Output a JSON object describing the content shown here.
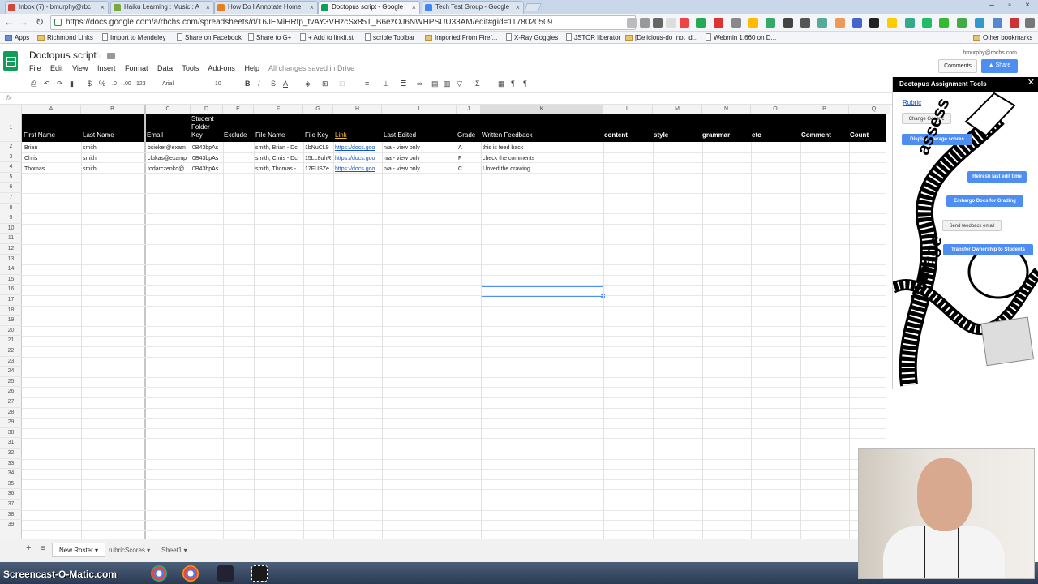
{
  "browser": {
    "tabs": [
      {
        "label": "Inbox (7) - bmurphy@rbc",
        "color": "#d44638"
      },
      {
        "label": "Haiku Learning : Music : A",
        "color": "#7aa83a"
      },
      {
        "label": "How Do I Annotate Home",
        "color": "#e67e22"
      },
      {
        "label": "Doctopus script - Google",
        "color": "#0f9d58",
        "active": true
      },
      {
        "label": "Tech Test Group - Google",
        "color": "#4285f4"
      }
    ],
    "url": "https://docs.google.com/a/rbchs.com/spreadsheets/d/16JEMiHRtp_tvAY3VHzcSx85T_B6ezOJ6NWHPSUU33AM/edit#gid=1178020509",
    "bookmarks": [
      "Apps",
      "Richmond Links",
      "Import to Mendeley",
      "Share on Facebook",
      "Share to G+",
      "+ Add to linkli.st",
      "scrible Toolbar",
      "Imported From Firef...",
      "X-Ray Goggles",
      "JSTOR liberator",
      "[Delicious-do_not_d...",
      "Webmin 1.660 on D...",
      "Other bookmarks"
    ]
  },
  "sheets": {
    "title": "Doctopus script",
    "menus": [
      "File",
      "Edit",
      "View",
      "Insert",
      "Format",
      "Data",
      "Tools",
      "Add-ons",
      "Help"
    ],
    "saved_status": "All changes saved in Drive",
    "user": "bmurphy@rbchs.com",
    "comments_label": "Comments",
    "share_label": "Share",
    "font_name": "Arial",
    "font_size": "10",
    "number_format": "123",
    "fx": "fx"
  },
  "grid": {
    "columns": [
      "A",
      "B",
      "C",
      "D",
      "E",
      "F",
      "G",
      "H",
      "I",
      "J",
      "K",
      "L",
      "M",
      "N",
      "O",
      "P",
      "Q"
    ],
    "headers": {
      "first_name": "First Name",
      "last_name": "Last Name",
      "email": "Email",
      "student_folder_key_1": "Student",
      "student_folder_key_2": "Folder",
      "student_folder_key_3": "Key",
      "exclude": "Exclude",
      "file_name": "File Name",
      "file_key": "File Key",
      "link": "Link",
      "last_edited": "Last Edited",
      "grade": "Grade",
      "written_feedback": "Written Feedback",
      "content": "content",
      "style": "style",
      "grammar": "grammar",
      "etc": "etc",
      "comment": "Comment",
      "count": "Count"
    },
    "rows": [
      {
        "first": "Brian",
        "last": "smith",
        "email": "bsieker@exam",
        "folder": "0B43bpAs",
        "file_name": "smith, Brian - Dc",
        "file_key": "1bNuCL9",
        "link": "https://docs.goo",
        "edited": "n/a - view only",
        "grade": "A",
        "feedback": "this is feed back"
      },
      {
        "first": "Chris",
        "last": "smith",
        "email": "clukas@examp",
        "folder": "0B43bpAs",
        "file_name": "smith, Chris - Dc",
        "file_key": "15LL8uhR",
        "link": "https://docs.goo",
        "edited": "n/a - view only",
        "grade": "F",
        "feedback": "check the comments"
      },
      {
        "first": "Thomas",
        "last": "smith",
        "email": "todarczenko@",
        "folder": "0B43bpAs",
        "file_name": "smith, Thomas -",
        "file_key": "17FUSZe",
        "link": "https://docs.goo",
        "edited": "n/a - view only",
        "grade": "C",
        "feedback": "I loved the drawing"
      }
    ],
    "row_numbers": [
      "1",
      "2",
      "3",
      "4",
      "5",
      "6",
      "7",
      "8",
      "9",
      "10",
      "11",
      "12",
      "13",
      "14",
      "15",
      "16",
      "17",
      "18",
      "19",
      "20",
      "21",
      "22",
      "23",
      "24",
      "25",
      "26",
      "27",
      "28",
      "29",
      "30",
      "31",
      "32",
      "33",
      "34",
      "35",
      "36",
      "37",
      "38",
      "39"
    ]
  },
  "sheet_tabs": [
    "New Roster",
    "rubricScores",
    "Sheet1"
  ],
  "panel": {
    "title": "Doctopus Assignment Tools",
    "rubric": "Rubric",
    "change_goobric": "Change Goobric",
    "display_avg": "Display average scores",
    "refresh": "Refresh last edit time",
    "embargo": "Embargo Docs for Grading",
    "send_feedback": "Send feedback email",
    "transfer": "Transfer Ownership to Students",
    "art_assess": "assess",
    "art_manage": "manage"
  },
  "taskbar": {
    "brand": "Screencast-O-Matic.com"
  }
}
